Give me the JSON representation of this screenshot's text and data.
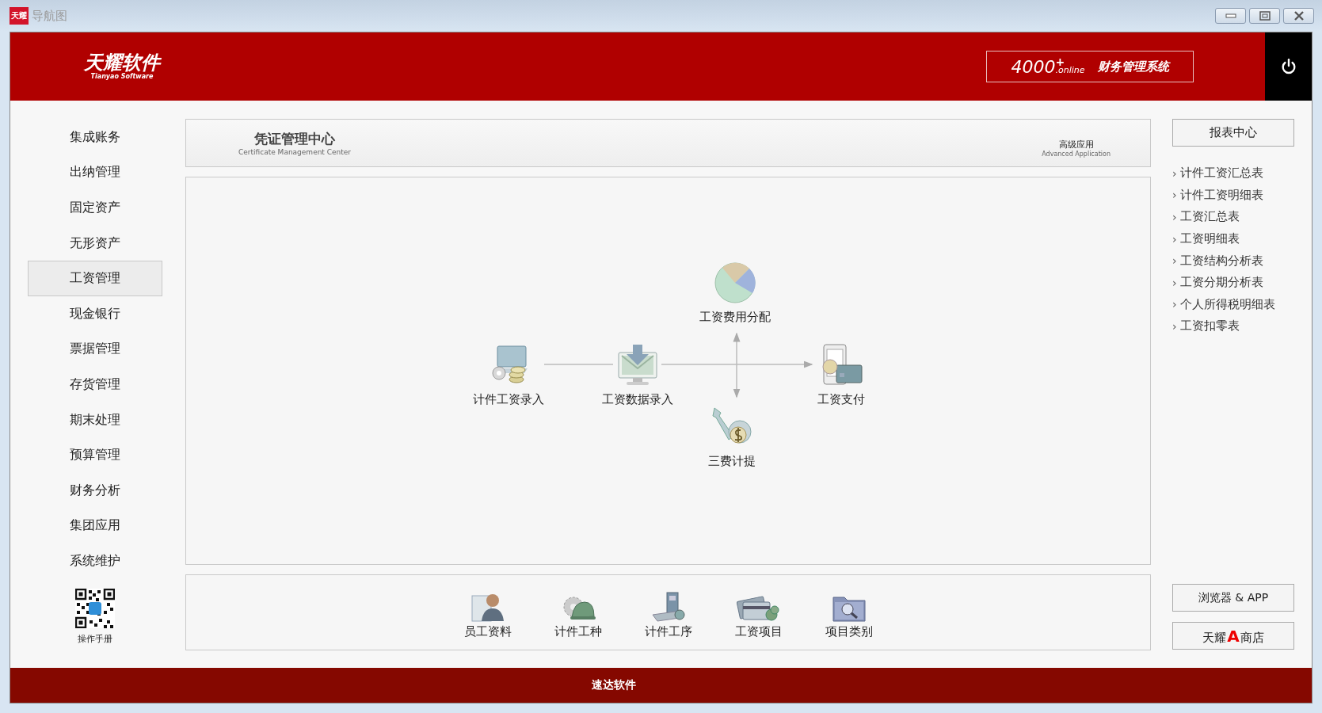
{
  "window": {
    "title": "导航图",
    "app_icon_label": "天耀"
  },
  "header": {
    "logo": "天耀软件",
    "logo_subtitle": "Tianyao Software",
    "product_number": "4000",
    "product_sup": "+",
    "product_suffix": ".online",
    "product_name": "财务管理系统"
  },
  "sidebar": {
    "items": [
      {
        "label": "集成账务",
        "selected": false
      },
      {
        "label": "出纳管理",
        "selected": false
      },
      {
        "label": "固定资产",
        "selected": false
      },
      {
        "label": "无形资产",
        "selected": false
      },
      {
        "label": "工资管理",
        "selected": true
      },
      {
        "label": "现金银行",
        "selected": false
      },
      {
        "label": "票据管理",
        "selected": false
      },
      {
        "label": "存货管理",
        "selected": false
      },
      {
        "label": "期末处理",
        "selected": false
      },
      {
        "label": "预算管理",
        "selected": false
      },
      {
        "label": "财务分析",
        "selected": false
      },
      {
        "label": "集团应用",
        "selected": false
      },
      {
        "label": "系统维护",
        "selected": false
      }
    ],
    "manual_label": "操作手册"
  },
  "center_header": {
    "title": "凭证管理中心",
    "subtitle": "Certificate Management Center",
    "advanced": "高级应用",
    "advanced_subtitle": "Advanced Application"
  },
  "diagram": {
    "nodes": [
      {
        "label": "计件工资录入",
        "kind": "coins"
      },
      {
        "label": "工资数据录入",
        "kind": "monitor"
      },
      {
        "label": "工资费用分配",
        "kind": "pie"
      },
      {
        "label": "工资支付",
        "kind": "card"
      },
      {
        "label": "三费计提",
        "kind": "wrench"
      }
    ]
  },
  "shortcuts": [
    {
      "label": "员工资料",
      "kind": "person"
    },
    {
      "label": "计件工种",
      "kind": "helmet"
    },
    {
      "label": "计件工序",
      "kind": "tools"
    },
    {
      "label": "工资项目",
      "kind": "cards"
    },
    {
      "label": "项目类别",
      "kind": "folder"
    }
  ],
  "reports": {
    "button": "报表中心",
    "items": [
      {
        "arrow": "›",
        "label": "计件工资汇总表"
      },
      {
        "arrow": "›",
        "label": "计件工资明细表"
      },
      {
        "arrow": "›",
        "label": "工资汇总表"
      },
      {
        "arrow": "›",
        "label": "工资明细表"
      },
      {
        "arrow": "›",
        "label": "工资结构分析表"
      },
      {
        "arrow": "›",
        "label": "工资分期分析表"
      },
      {
        "arrow": "›",
        "label": "个人所得税明细表"
      },
      {
        "arrow": "›",
        "label": "工资扣零表"
      }
    ]
  },
  "buttons": [
    {
      "label": "浏览器 & APP"
    },
    {
      "before": "天耀",
      "mark": "A",
      "after": "商店"
    }
  ],
  "footer": {
    "text": "速达软件"
  }
}
